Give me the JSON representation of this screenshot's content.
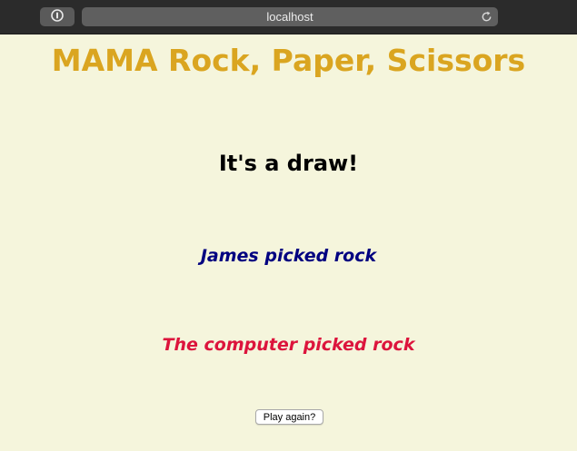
{
  "browser": {
    "address": "localhost",
    "icons": {
      "extension": "password-manager-icon",
      "reload": "reload-icon"
    }
  },
  "page": {
    "title": "MAMA Rock, Paper, Scissors",
    "result": "It's a draw!",
    "player_pick": "James picked rock",
    "computer_pick": "The computer picked rock",
    "play_again_label": "Play again?"
  },
  "colors": {
    "background": "#f5f5dc",
    "title": "#daa520",
    "player": "#000080",
    "computer": "#dc143c"
  }
}
